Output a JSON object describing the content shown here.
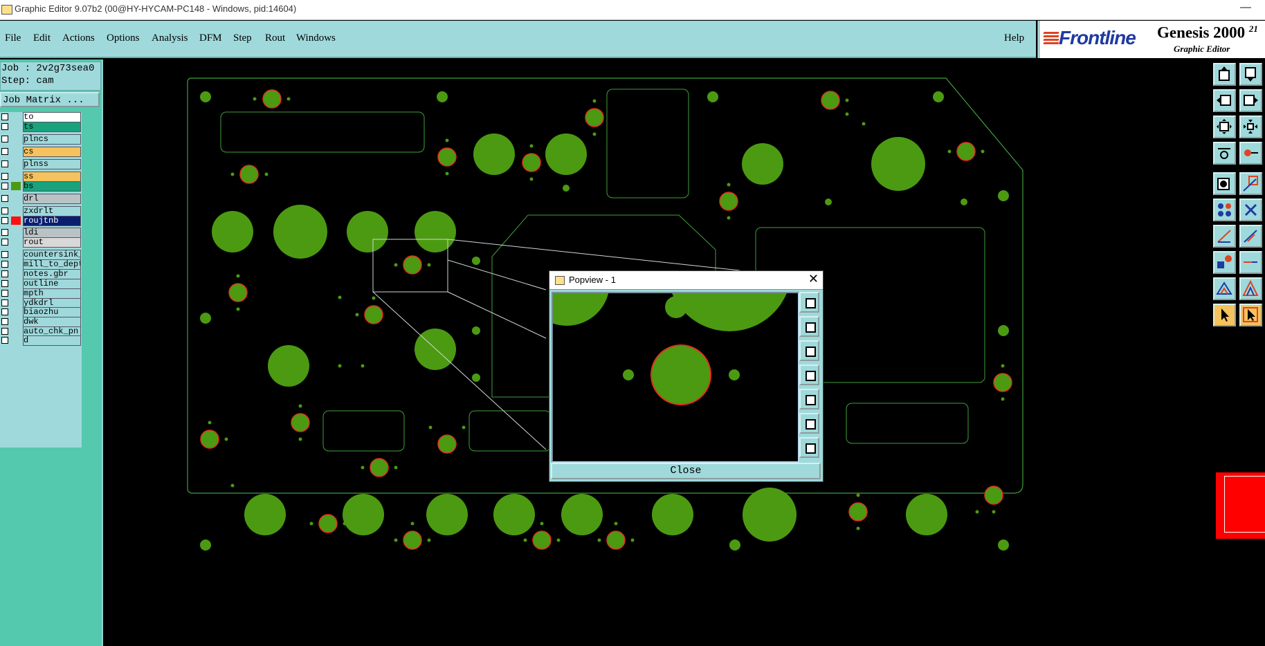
{
  "window": {
    "title": "Graphic Editor 9.07b2 (00@HY-HYCAM-PC148 - Windows, pid:14604)",
    "minimize": "—"
  },
  "menu": {
    "items": [
      "File",
      "Edit",
      "Actions",
      "Options",
      "Analysis",
      "DFM",
      "Step",
      "Rout",
      "Windows"
    ],
    "help": "Help"
  },
  "brand": {
    "logo": "Frontline",
    "product": "Genesis 2000",
    "version_sup": "21",
    "subtitle": "Graphic Editor"
  },
  "job": {
    "job_line": "Job : 2v2g73sea0",
    "step_line": "Step: cam",
    "matrix_button": "Job Matrix ..."
  },
  "layers": [
    {
      "name": "to",
      "bg": "#ffffff",
      "swatch": ""
    },
    {
      "name": "ts",
      "bg": "#19a27c",
      "swatch": ""
    },
    {
      "name": "plncs",
      "bg": "#9fd9db",
      "swatch": ""
    },
    {
      "name": "cs",
      "bg": "#f6c25d",
      "swatch": ""
    },
    {
      "name": "plnss",
      "bg": "#9fd9db",
      "swatch": ""
    },
    {
      "name": "ss",
      "bg": "#f6c25d",
      "swatch": ""
    },
    {
      "name": "bs",
      "bg": "#19a27c",
      "swatch": "#4c9a12"
    },
    {
      "name": "drl",
      "bg": "#b9c3c6",
      "swatch": ""
    },
    {
      "name": "zxdrlt",
      "bg": "#9fd9db",
      "swatch": ""
    },
    {
      "name": "roujtnb",
      "bg": "#0a1e70",
      "swatch": "#ff1010"
    },
    {
      "name": "ldi",
      "bg": "#b9c3c6",
      "swatch": ""
    },
    {
      "name": "rout",
      "bg": "#d8d8d8",
      "swatch": ""
    },
    {
      "name": "countersink_",
      "bg": "#9fd9db",
      "swatch": ""
    },
    {
      "name": "mill_to_dept",
      "bg": "#9fd9db",
      "swatch": ""
    },
    {
      "name": "notes.gbr",
      "bg": "#9fd9db",
      "swatch": ""
    },
    {
      "name": "outline",
      "bg": "#9fd9db",
      "swatch": ""
    },
    {
      "name": "mpth",
      "bg": "#9fd9db",
      "swatch": ""
    },
    {
      "name": "ydkdrl",
      "bg": "#9fd9db",
      "swatch": ""
    },
    {
      "name": "biaozhu",
      "bg": "#9fd9db",
      "swatch": ""
    },
    {
      "name": "dwk",
      "bg": "#9fd9db",
      "swatch": ""
    },
    {
      "name": "auto_chk_pn",
      "bg": "#9fd9db",
      "swatch": ""
    },
    {
      "name": "d",
      "bg": "#9fd9db",
      "swatch": ""
    }
  ],
  "popview": {
    "title": "Popview - 1",
    "close_label": "Close",
    "close_x": "✕"
  },
  "colors": {
    "pad_green": "#4c9a12",
    "outline_green": "#3fa03a",
    "highlight_red": "#e0301e",
    "panel_teal": "#55c9ae",
    "ui_cyan": "#9fd9db"
  }
}
